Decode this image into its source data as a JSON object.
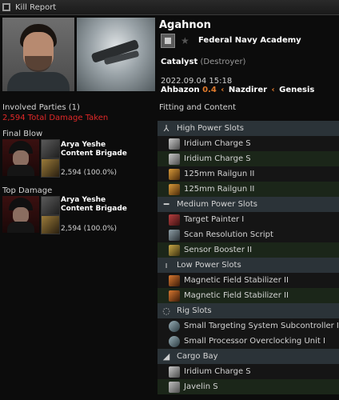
{
  "window": {
    "title": "Kill Report"
  },
  "victim": {
    "name": "Agahnon",
    "corporation": "Federal Navy Academy",
    "ship": "Catalyst",
    "ship_class": "(Destroyer)",
    "timestamp": "2022.09.04 15:18",
    "location": {
      "system": "Ahbazon",
      "security": "0.4",
      "constellation": "Nazdirer",
      "region": "Genesis"
    }
  },
  "involved": {
    "title": "Involved Parties (1)",
    "total_damage": "2,594 Total Damage Taken",
    "final_blow_label": "Final Blow",
    "top_damage_label": "Top Damage",
    "final_blow": {
      "name": "Arya Yeshe",
      "corp": "Content Brigade",
      "damage": "2,594 (100.0%)"
    },
    "top_damage": {
      "name": "Arya Yeshe",
      "corp": "Content Brigade",
      "damage": "2,594 (100.0%)"
    }
  },
  "fitting": {
    "title": "Fitting and Content",
    "sections": {
      "high": {
        "label": "High Power Slots",
        "items": [
          "Iridium Charge S",
          "Iridium Charge S",
          "125mm Railgun II",
          "125mm Railgun II"
        ]
      },
      "medium": {
        "label": "Medium Power Slots",
        "items": [
          "Target Painter I",
          "Scan Resolution Script",
          "Sensor Booster II"
        ]
      },
      "low": {
        "label": "Low Power Slots",
        "items": [
          "Magnetic Field Stabilizer II",
          "Magnetic Field Stabilizer II"
        ]
      },
      "rig": {
        "label": "Rig Slots",
        "items": [
          "Small Targeting System Subcontroller I",
          "Small Processor Overclocking Unit I"
        ]
      },
      "cargo": {
        "label": "Cargo Bay",
        "items": [
          "Iridium Charge S",
          "Javelin S"
        ]
      }
    }
  },
  "colors": {
    "damage_red": "#e02828",
    "security_orange": "#e07a2c",
    "dropped_green": "#1b2619",
    "section_header": "#2b3338"
  }
}
